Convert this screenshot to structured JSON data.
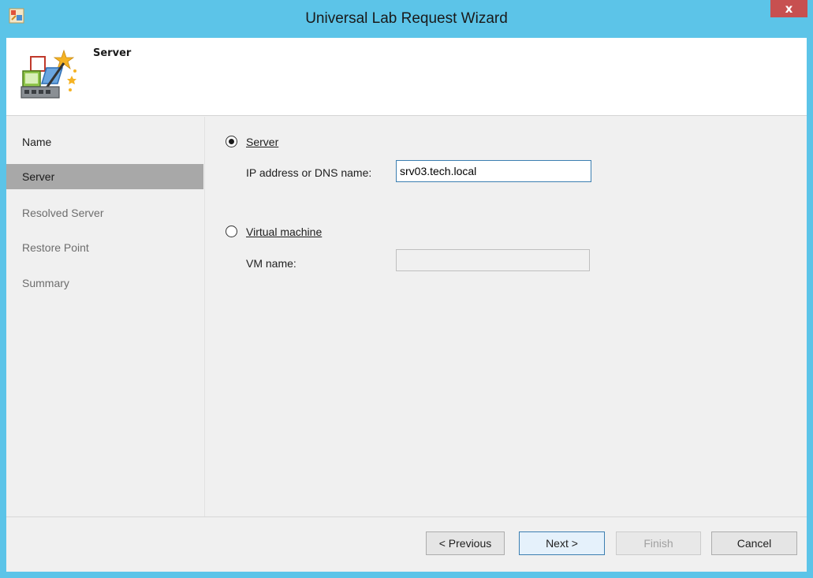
{
  "window": {
    "title": "Universal Lab Request Wizard",
    "close_label": "x"
  },
  "header": {
    "step_title": "Server"
  },
  "nav": {
    "items": [
      {
        "label": "Name",
        "state": "normal"
      },
      {
        "label": "Server",
        "state": "selected"
      },
      {
        "label": "Resolved Server",
        "state": "disabled"
      },
      {
        "label": "Restore Point",
        "state": "disabled"
      },
      {
        "label": "Summary",
        "state": "disabled"
      }
    ]
  },
  "main": {
    "server_option": {
      "label": "Server",
      "checked": true
    },
    "ip_label": "IP address or DNS name:",
    "ip_value": "srv03.tech.local",
    "vm_option": {
      "label": "Virtual machine",
      "checked": false
    },
    "vm_label": "VM name:",
    "vm_value": ""
  },
  "footer": {
    "previous_label": "< Previous",
    "next_label": "Next >",
    "finish_label": "Finish",
    "cancel_label": "Cancel"
  },
  "colors": {
    "titlebar": "#5cc4e8",
    "close_button": "#c75050",
    "selected_nav": "#a8a8a8",
    "focus_border": "#3c7fb1"
  }
}
